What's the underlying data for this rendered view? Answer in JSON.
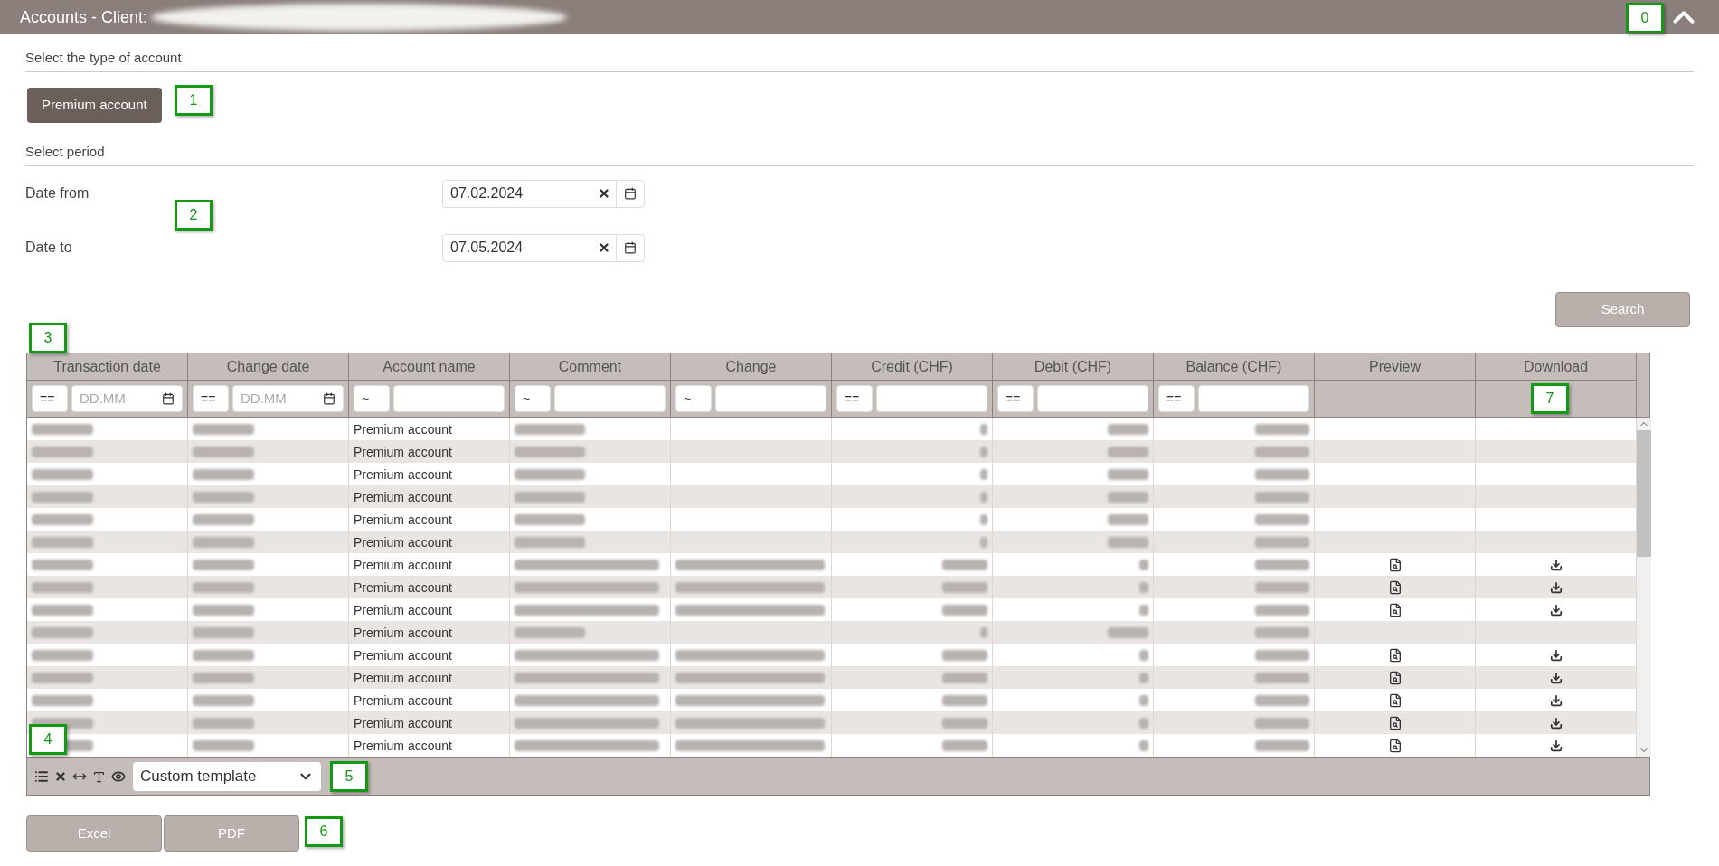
{
  "header": {
    "title": "Accounts - Client:"
  },
  "account_section": {
    "heading": "Select the type of account",
    "accounts": [
      {
        "label": "Premium account",
        "selected": true
      }
    ]
  },
  "period_section": {
    "heading": "Select period",
    "fields": [
      {
        "label": "Date from",
        "value": "07.02.2024"
      },
      {
        "label": "Date to",
        "value": "07.05.2024"
      }
    ]
  },
  "search_button": "Search",
  "table": {
    "columns": [
      {
        "label": "Transaction date",
        "kind": "date",
        "operator": "==",
        "placeholder": "DD.MM"
      },
      {
        "label": "Change date",
        "kind": "date",
        "operator": "==",
        "placeholder": "DD.MM"
      },
      {
        "label": "Account name",
        "kind": "text",
        "operator": "~"
      },
      {
        "label": "Comment",
        "kind": "text",
        "operator": "~"
      },
      {
        "label": "Change",
        "kind": "text",
        "operator": "~"
      },
      {
        "label": "Credit (CHF)",
        "kind": "number",
        "operator": "=="
      },
      {
        "label": "Debit (CHF)",
        "kind": "number",
        "operator": "=="
      },
      {
        "label": "Balance (CHF)",
        "kind": "number",
        "operator": "=="
      },
      {
        "label": "Preview",
        "kind": "none"
      },
      {
        "label": "Download",
        "kind": "none"
      }
    ],
    "rows": [
      {
        "account": "Premium account",
        "documents": false
      },
      {
        "account": "Premium account",
        "documents": false
      },
      {
        "account": "Premium account",
        "documents": false
      },
      {
        "account": "Premium account",
        "documents": false
      },
      {
        "account": "Premium account",
        "documents": false
      },
      {
        "account": "Premium account",
        "documents": false
      },
      {
        "account": "Premium account",
        "documents": true
      },
      {
        "account": "Premium account",
        "documents": true
      },
      {
        "account": "Premium account",
        "documents": true
      },
      {
        "account": "Premium account",
        "documents": false
      },
      {
        "account": "Premium account",
        "documents": true
      },
      {
        "account": "Premium account",
        "documents": true
      },
      {
        "account": "Premium account",
        "documents": true
      },
      {
        "account": "Premium account",
        "documents": true
      },
      {
        "account": "Premium account",
        "documents": true
      }
    ],
    "template": "Custom template"
  },
  "export_buttons": [
    "Excel",
    "PDF"
  ],
  "markers": [
    {
      "label": "0"
    },
    {
      "label": "1"
    },
    {
      "label": "2"
    },
    {
      "label": "3"
    },
    {
      "label": "4"
    },
    {
      "label": "5"
    },
    {
      "label": "6"
    },
    {
      "label": "7"
    }
  ]
}
